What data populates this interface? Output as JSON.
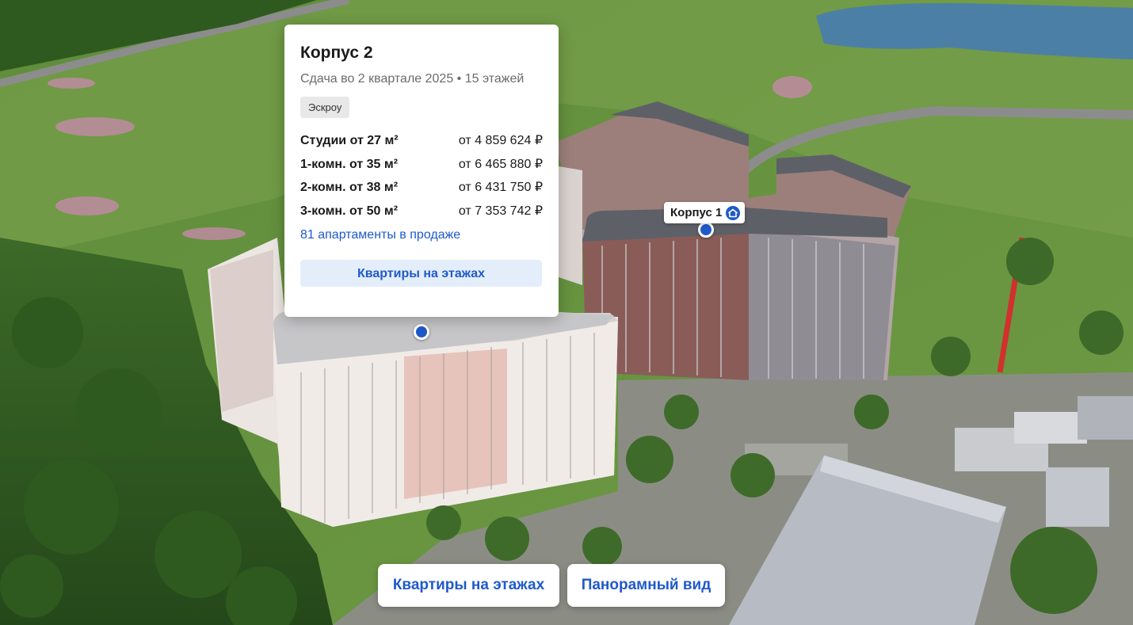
{
  "popup": {
    "title": "Корпус 2",
    "subtitle": "Сдача во 2 квартале 2025 • 15 этажей",
    "badge": "Эскроу",
    "rows": [
      {
        "type": "Студии от 27 м²",
        "price": "от 4 859 624 ₽"
      },
      {
        "type": "1-комн. от 35 м²",
        "price": "от 6 465 880 ₽"
      },
      {
        "type": "2-комн. от 38 м²",
        "price": "от 6 431 750 ₽"
      },
      {
        "type": "3-комн. от 50 м²",
        "price": "от 7 353 742 ₽"
      }
    ],
    "link": "81 апартаменты в продаже",
    "button": "Квартиры на этажах"
  },
  "building_label": {
    "text": "Корпус 1",
    "icon": "home-icon"
  },
  "bottom_buttons": {
    "floors": "Квартиры на этажах",
    "panorama": "Панорамный вид"
  },
  "colors": {
    "accent": "#1f5ac9",
    "accent_light": "#e4eefb"
  }
}
